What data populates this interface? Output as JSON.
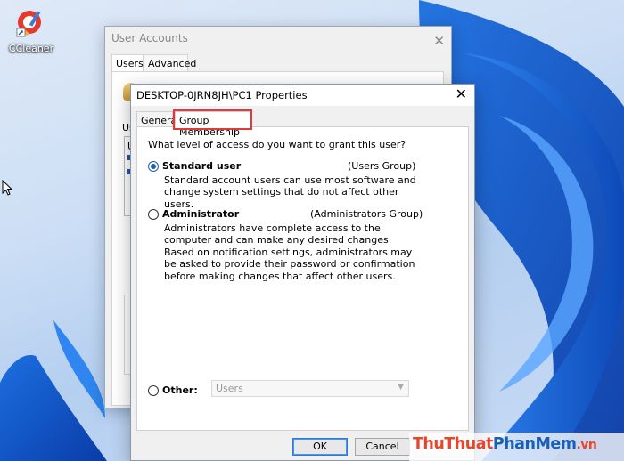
{
  "desktop": {
    "icon_label": "CCleaner"
  },
  "ua_window": {
    "title": "User Accounts",
    "tabs": [
      "Users",
      "Advanced"
    ],
    "partial_label_us": "Us",
    "partial_label_u": "U",
    "partial_label_p": "P"
  },
  "dialog": {
    "title": "DESKTOP-0JRN8JH\\PC1 Properties",
    "tabs": [
      "General",
      "Group Membership"
    ],
    "question": "What level of access do you want to grant this user?",
    "options": [
      {
        "label": "Standard user",
        "group": "(Users Group)",
        "description": "Standard account users can use most software and change system settings that do not affect other users.",
        "checked": true
      },
      {
        "label": "Administrator",
        "group": "(Administrators Group)",
        "description": "Administrators have complete access to the computer and can make any desired changes. Based on notification settings, administrators may be asked to provide their password or confirmation before making changes that affect other users.",
        "checked": false
      },
      {
        "label": "Other:",
        "checked": false
      }
    ],
    "other_select_value": "Users",
    "buttons": {
      "ok": "OK",
      "cancel": "Cancel"
    },
    "highlight_color": "#e03a3a"
  },
  "watermark": {
    "part1": "ThuThuat",
    "part2": "PhanMem",
    "part3": ".vn"
  }
}
